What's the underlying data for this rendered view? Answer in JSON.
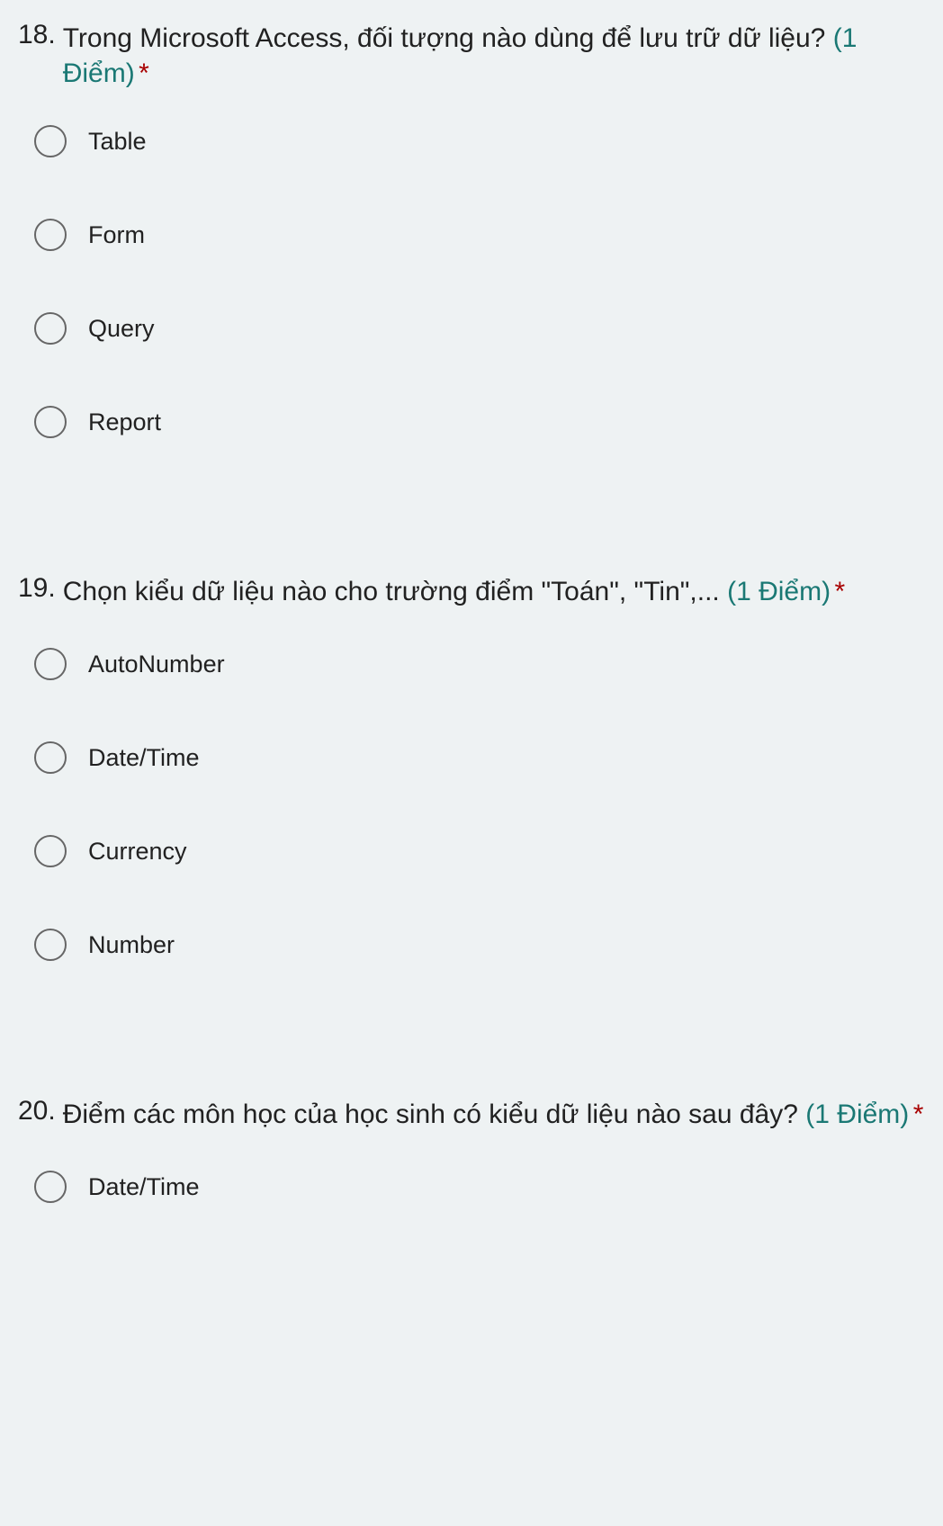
{
  "questions": [
    {
      "number": "18.",
      "text": "Trong Microsoft Access, đối tượng nào dùng để lưu trữ dữ liệu? ",
      "points": "(1 Điểm)",
      "required": " *",
      "options": [
        {
          "label": "Table"
        },
        {
          "label": "Form"
        },
        {
          "label": "Query"
        },
        {
          "label": "Report"
        }
      ]
    },
    {
      "number": "19.",
      "text": "Chọn kiểu dữ liệu nào cho trường điểm \"Toán\", \"Tin\",... ",
      "points": "(1 Điểm)",
      "required": " *",
      "options": [
        {
          "label": "AutoNumber"
        },
        {
          "label": "Date/Time"
        },
        {
          "label": "Currency"
        },
        {
          "label": "Number"
        }
      ]
    },
    {
      "number": "20.",
      "text": "Điểm các môn học của học sinh có kiểu dữ liệu nào sau đây? ",
      "points": "(1 Điểm)",
      "required": " *",
      "options": [
        {
          "label": "Date/Time"
        }
      ]
    }
  ]
}
